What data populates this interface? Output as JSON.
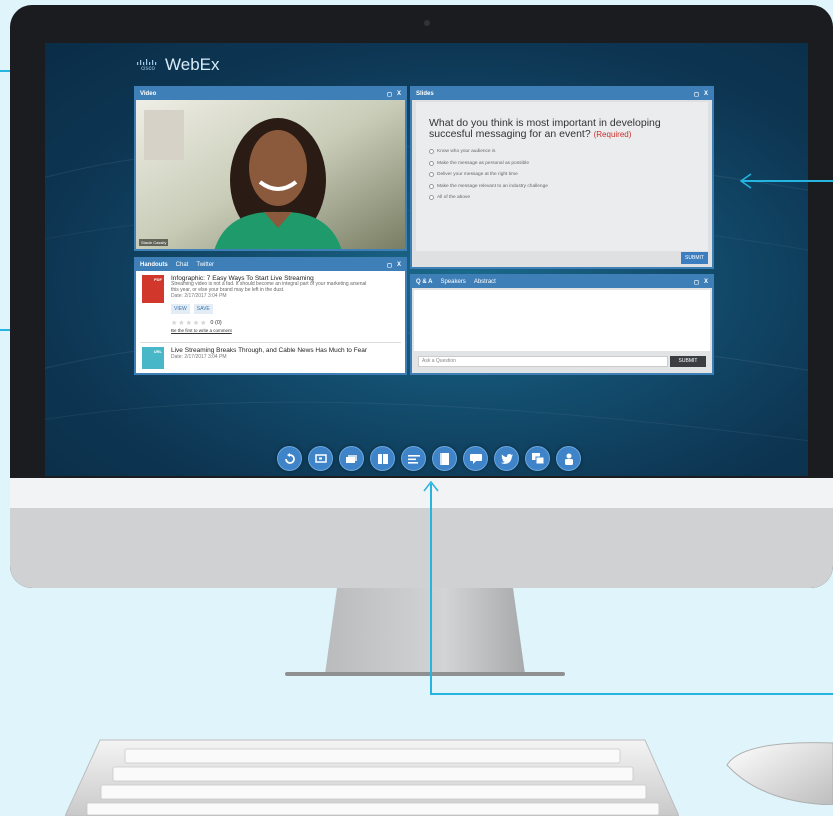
{
  "brand": {
    "cisco": "cisco",
    "product": "WebEx"
  },
  "video_panel": {
    "title": "Video",
    "name_tag": "Stacie Cassity"
  },
  "slides_panel": {
    "title": "Slides",
    "question": "What do you think is most important in developing succesful messaging for an event?",
    "required": "(Required)",
    "options": [
      "Know who your audience is",
      "Make the message as personal as possible",
      "Deliver your message at the right time",
      "Make the message relevant to an industry challenge",
      "All of the above"
    ],
    "submit": "SUBMIT"
  },
  "handouts_panel": {
    "tabs": [
      "Handouts",
      "Chat",
      "Twitter"
    ],
    "items": [
      {
        "badge": "PDF",
        "title": "Infographic: 7 Easy Ways To Start Live Streaming",
        "desc": "Streaming video is not a fad. It should become an integral part of your marketing arsenal this year, or else your brand may be left in the dust.",
        "date": "Date: 2/17/2017 3:04 PM",
        "view": "VIEW",
        "save": "SAVE",
        "rating": "0 (0)",
        "review_link": "Be the first to write a comment"
      },
      {
        "badge": "URL",
        "title": "Live Streaming Breaks Through, and Cable News Has Much to Fear",
        "date": "Date: 2/17/2017 3:04 PM"
      }
    ]
  },
  "qa_panel": {
    "tabs": [
      "Q & A",
      "Speakers",
      "Abstract"
    ],
    "placeholder": "Ask a Question",
    "submit": "SUBMIT"
  },
  "panel_controls": {
    "restore": "◻",
    "close": "X"
  },
  "dock_icons": [
    "refresh-icon",
    "screen-icon",
    "slides-icon",
    "handouts-icon",
    "agenda-icon",
    "document-icon",
    "chat-icon",
    "twitter-icon",
    "qa-icon",
    "survey-icon"
  ],
  "colors": {
    "accent": "#3f7fb8",
    "arrow": "#25b5e0",
    "required": "#c9302c"
  }
}
